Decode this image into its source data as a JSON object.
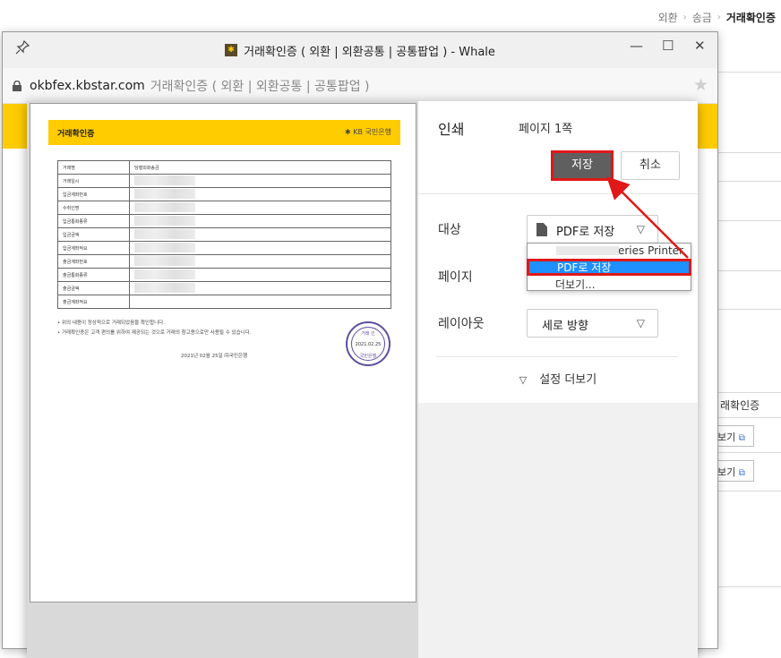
{
  "background": {
    "breadcrumb": [
      "외환",
      "송금",
      "거래확인증"
    ],
    "right_labels": [
      "래확인증"
    ],
    "view_buttons": [
      "보기",
      "보기"
    ]
  },
  "window": {
    "title": "거래확인증 ( 외환 | 외환공통 | 공통팝업 ) - Whale",
    "controls": [
      "—",
      "☐",
      "✕"
    ],
    "url_host": "okbfex.kbstar.com",
    "url_path": "거래확인증 ( 외환 | 외환공통 | 공통팝업 )"
  },
  "preview": {
    "doc_title": "거래확인증",
    "bank_logo": "✱ KB 국민은행",
    "rows": [
      {
        "label": "거래명",
        "value": "당행외화송금"
      },
      {
        "label": "거래일시",
        "value": ""
      },
      {
        "label": "입금계좌번호",
        "value": ""
      },
      {
        "label": "수취인명",
        "value": ""
      },
      {
        "label": "입금통화종류",
        "value": ""
      },
      {
        "label": "입금금액",
        "value": ""
      },
      {
        "label": "입금계좌적요",
        "value": ""
      },
      {
        "label": "출금계좌번호",
        "value": ""
      },
      {
        "label": "출금통화종류",
        "value": ""
      },
      {
        "label": "출금금액",
        "value": ""
      },
      {
        "label": "출금계좌적요",
        "value": ""
      }
    ],
    "note1": "• 위의 내용이 정상적으로 거래되었음을 확인합니다.",
    "note2": "• 거래확인증은 고객 편의를 위하여 제공되는 것으로 거래의 참고용으로만 사용될 수 있습니다.",
    "issue_date": "2021년  02월  25일  ㈜국민은행",
    "seal_top": "거래 인",
    "seal_date": "2021.02.25",
    "seal_bottom": "국민은행"
  },
  "print": {
    "title": "인쇄",
    "page_count": "페이지 1쪽",
    "save_label": "저장",
    "cancel_label": "취소",
    "destination_label": "대상",
    "destination_value": "PDF로 저장",
    "dropdown_options": [
      "series Printer",
      "PDF로 저장",
      "더보기..."
    ],
    "pages_label": "페이지",
    "layout_label": "레이아웃",
    "layout_value": "세로 방향",
    "more_settings": "설정 더보기"
  },
  "colors": {
    "kb_yellow": "#ffcc00",
    "highlight_red": "#e01818",
    "selection_blue": "#1e90ff",
    "save_button": "#5f5f5f"
  }
}
